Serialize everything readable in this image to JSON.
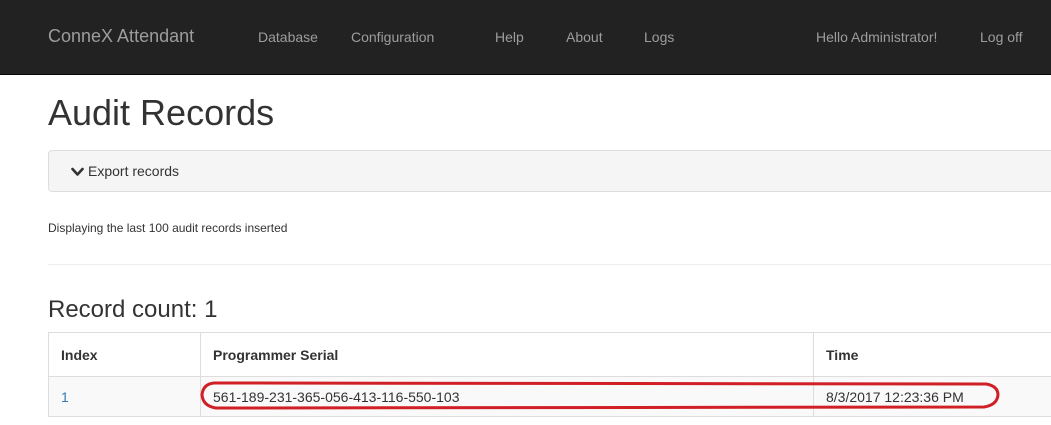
{
  "navbar": {
    "brand": "ConneX Attendant",
    "links": [
      "Database",
      "Configuration",
      "Help",
      "About",
      "Logs"
    ],
    "greeting": "Hello Administrator!",
    "logoff": "Log off"
  },
  "page": {
    "title": "Audit Records",
    "export_label": "Export records",
    "info": "Displaying the last 100 audit records inserted",
    "record_count": "Record count: 1"
  },
  "table": {
    "headers": [
      "Index",
      "Programmer Serial",
      "Time"
    ],
    "rows": [
      {
        "index": "1",
        "serial": "561-189-231-365-056-413-116-550-103",
        "time": "8/3/2017 12:23:36 PM"
      }
    ]
  },
  "colors": {
    "navbar_bg": "#222222",
    "nav_text": "#9d9d9d",
    "link": "#337ab7",
    "highlight": "#d11f26"
  },
  "icons": {
    "export_toggle": "chevron-down-icon"
  }
}
